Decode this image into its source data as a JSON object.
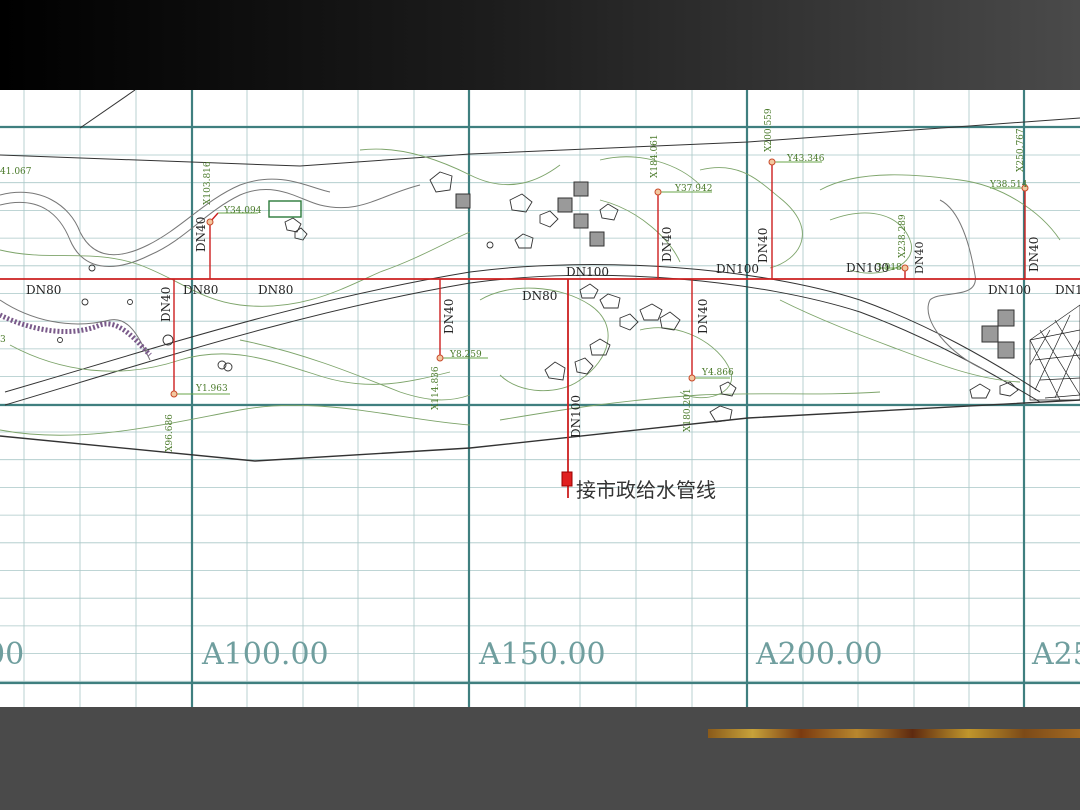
{
  "colors": {
    "background": "#ffffff",
    "fine_grid": "#a9c7c7",
    "major_grid": "#3f7f7f",
    "pipe": "#cc1f1f",
    "contour": "#7da46a",
    "label_green": "#4a7a2a",
    "outline": "#333333"
  },
  "station_labels": [
    "00",
    "A100.00",
    "A150.00",
    "A200.00",
    "A25"
  ],
  "main_pipe_labels": [
    "DN80",
    "DN80",
    "DN80",
    "DN80",
    "DN100",
    "DN100",
    "DN100",
    "DN100",
    "DN10"
  ],
  "branch_labels": [
    "DN40",
    "DN40",
    "DN40",
    "DN40",
    "DN40",
    "DN40",
    "DN40",
    "DN100"
  ],
  "coord_labels": [
    "41.067",
    "X103.816",
    "Y34.094",
    "X184.061",
    "Y37.942",
    "X200.559",
    "Y43.346",
    "X250.767",
    "Y38.514",
    "X238.289",
    "3.918",
    "Y1.963",
    "X96.686",
    "Y8.259",
    "X114.836",
    "Y4.866",
    "X180.201",
    "3"
  ],
  "connection_label": "接市政给水管线"
}
